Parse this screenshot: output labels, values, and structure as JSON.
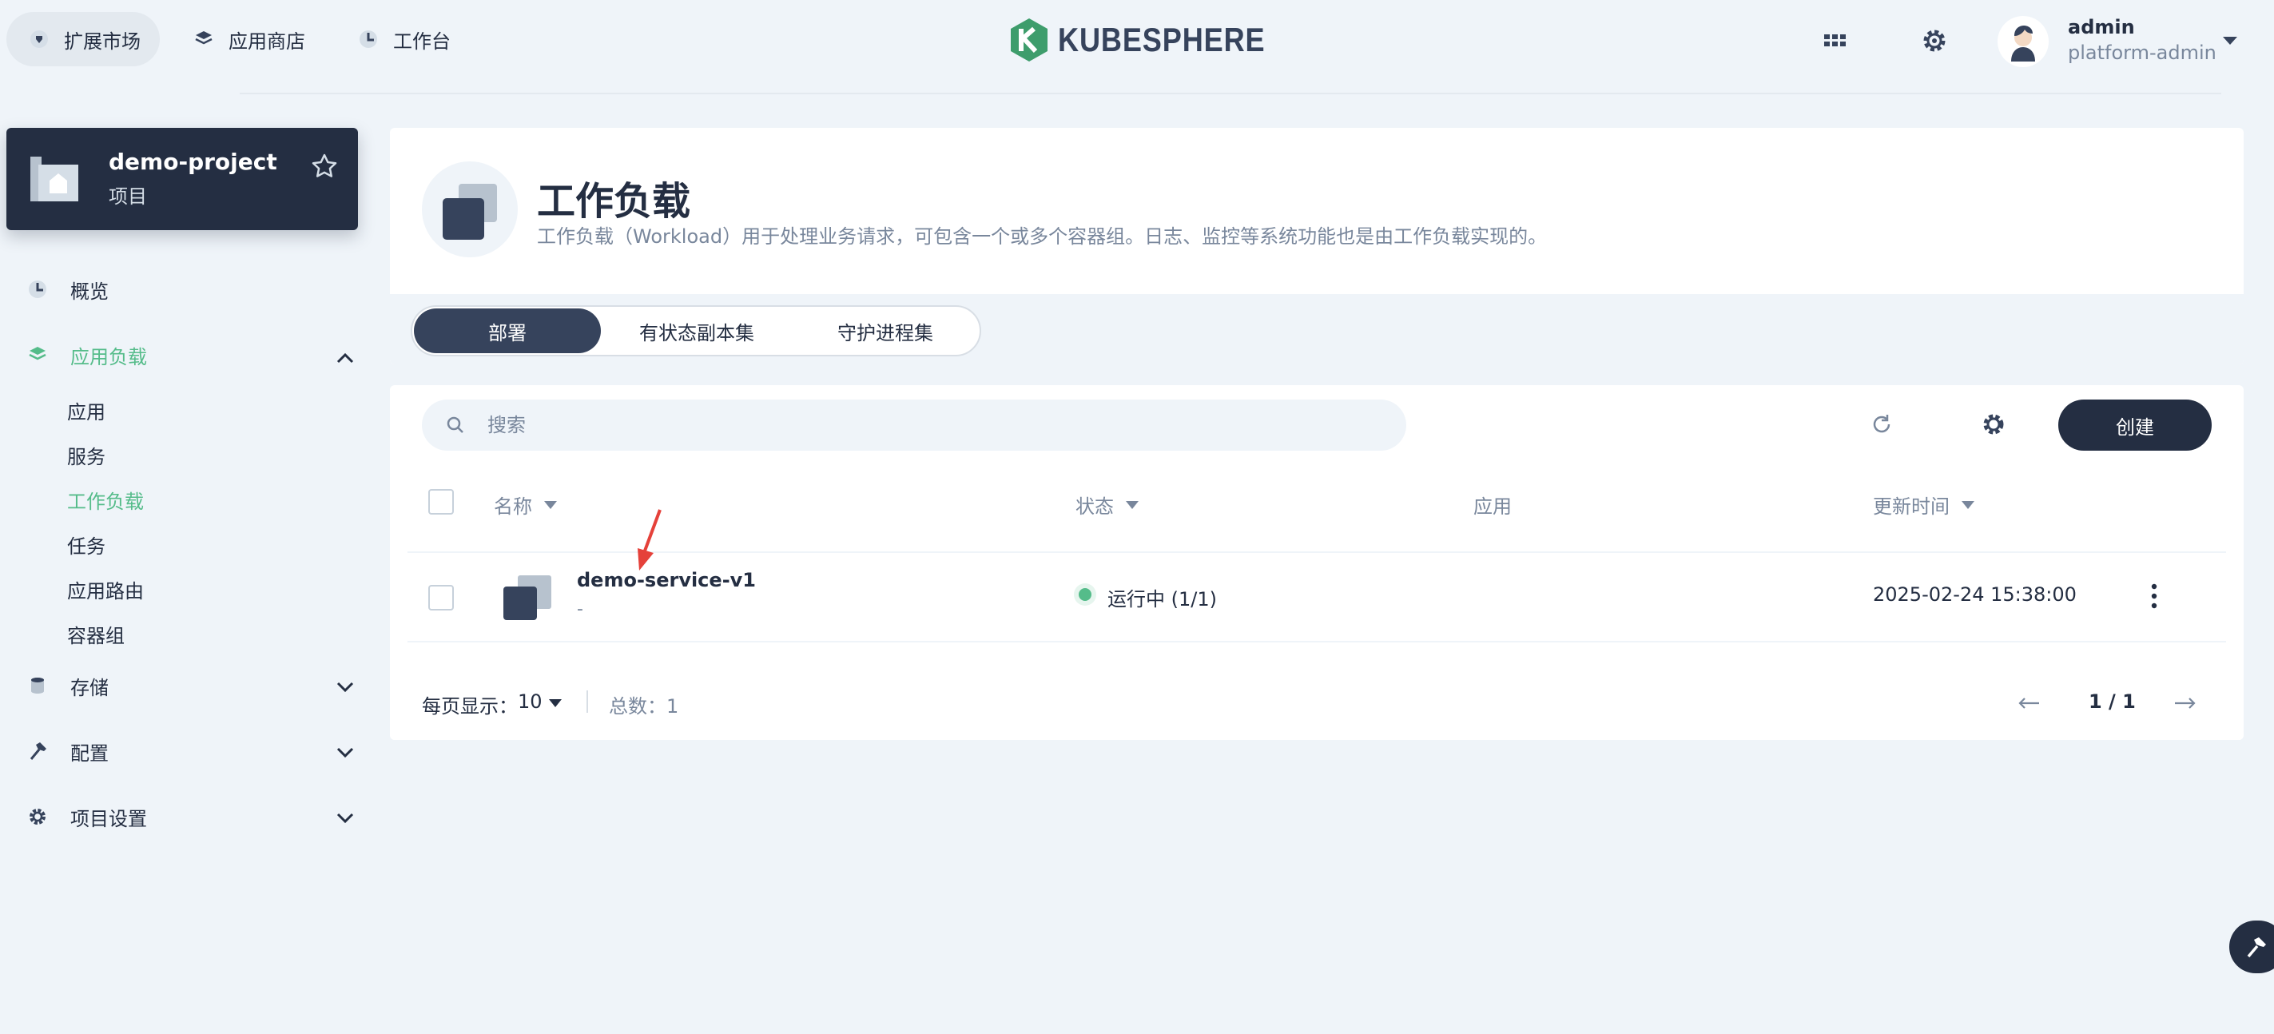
{
  "topnav": {
    "items": [
      {
        "label": "扩展市场",
        "icon": "extension-market-icon",
        "active": true
      },
      {
        "label": "应用商店",
        "icon": "app-store-icon",
        "active": false
      },
      {
        "label": "工作台",
        "icon": "workbench-icon",
        "active": false
      }
    ]
  },
  "logo": {
    "text": "KUBESPHERE",
    "brand_color": "#3e9d6c"
  },
  "user": {
    "name": "admin",
    "role": "platform-admin"
  },
  "project": {
    "name": "demo-project",
    "type": "项目"
  },
  "sidebar": {
    "overview": "概览",
    "app_workloads": {
      "label": "应用负载",
      "expanded": true,
      "children": [
        {
          "label": "应用",
          "active": false
        },
        {
          "label": "服务",
          "active": false
        },
        {
          "label": "工作负载",
          "active": true
        },
        {
          "label": "任务",
          "active": false
        },
        {
          "label": "应用路由",
          "active": false
        },
        {
          "label": "容器组",
          "active": false
        }
      ]
    },
    "storage": "存储",
    "config": "配置",
    "project_settings": "项目设置"
  },
  "header": {
    "title": "工作负载",
    "description": "工作负载（Workload）用于处理业务请求，可包含一个或多个容器组。日志、监控等系统功能也是由工作负载实现的。"
  },
  "tabs": [
    {
      "label": "部署",
      "active": true
    },
    {
      "label": "有状态副本集",
      "active": false
    },
    {
      "label": "守护进程集",
      "active": false
    }
  ],
  "toolbar": {
    "search_placeholder": "搜索",
    "create_label": "创建"
  },
  "table": {
    "columns": {
      "name": "名称",
      "status": "状态",
      "app": "应用",
      "updated": "更新时间"
    },
    "rows": [
      {
        "name": "demo-service-v1",
        "sub": "-",
        "status": "运行中 (1/1)",
        "app": "",
        "updated": "2025-02-24 15:38:00"
      }
    ]
  },
  "footer": {
    "page_size_label": "每页显示：",
    "page_size": "10",
    "total": "总数：1",
    "page": "1 / 1"
  },
  "colors": {
    "accent": "#55bc8a",
    "dark": "#242e42",
    "muted": "#79879c",
    "annotation": "#e5413a"
  }
}
